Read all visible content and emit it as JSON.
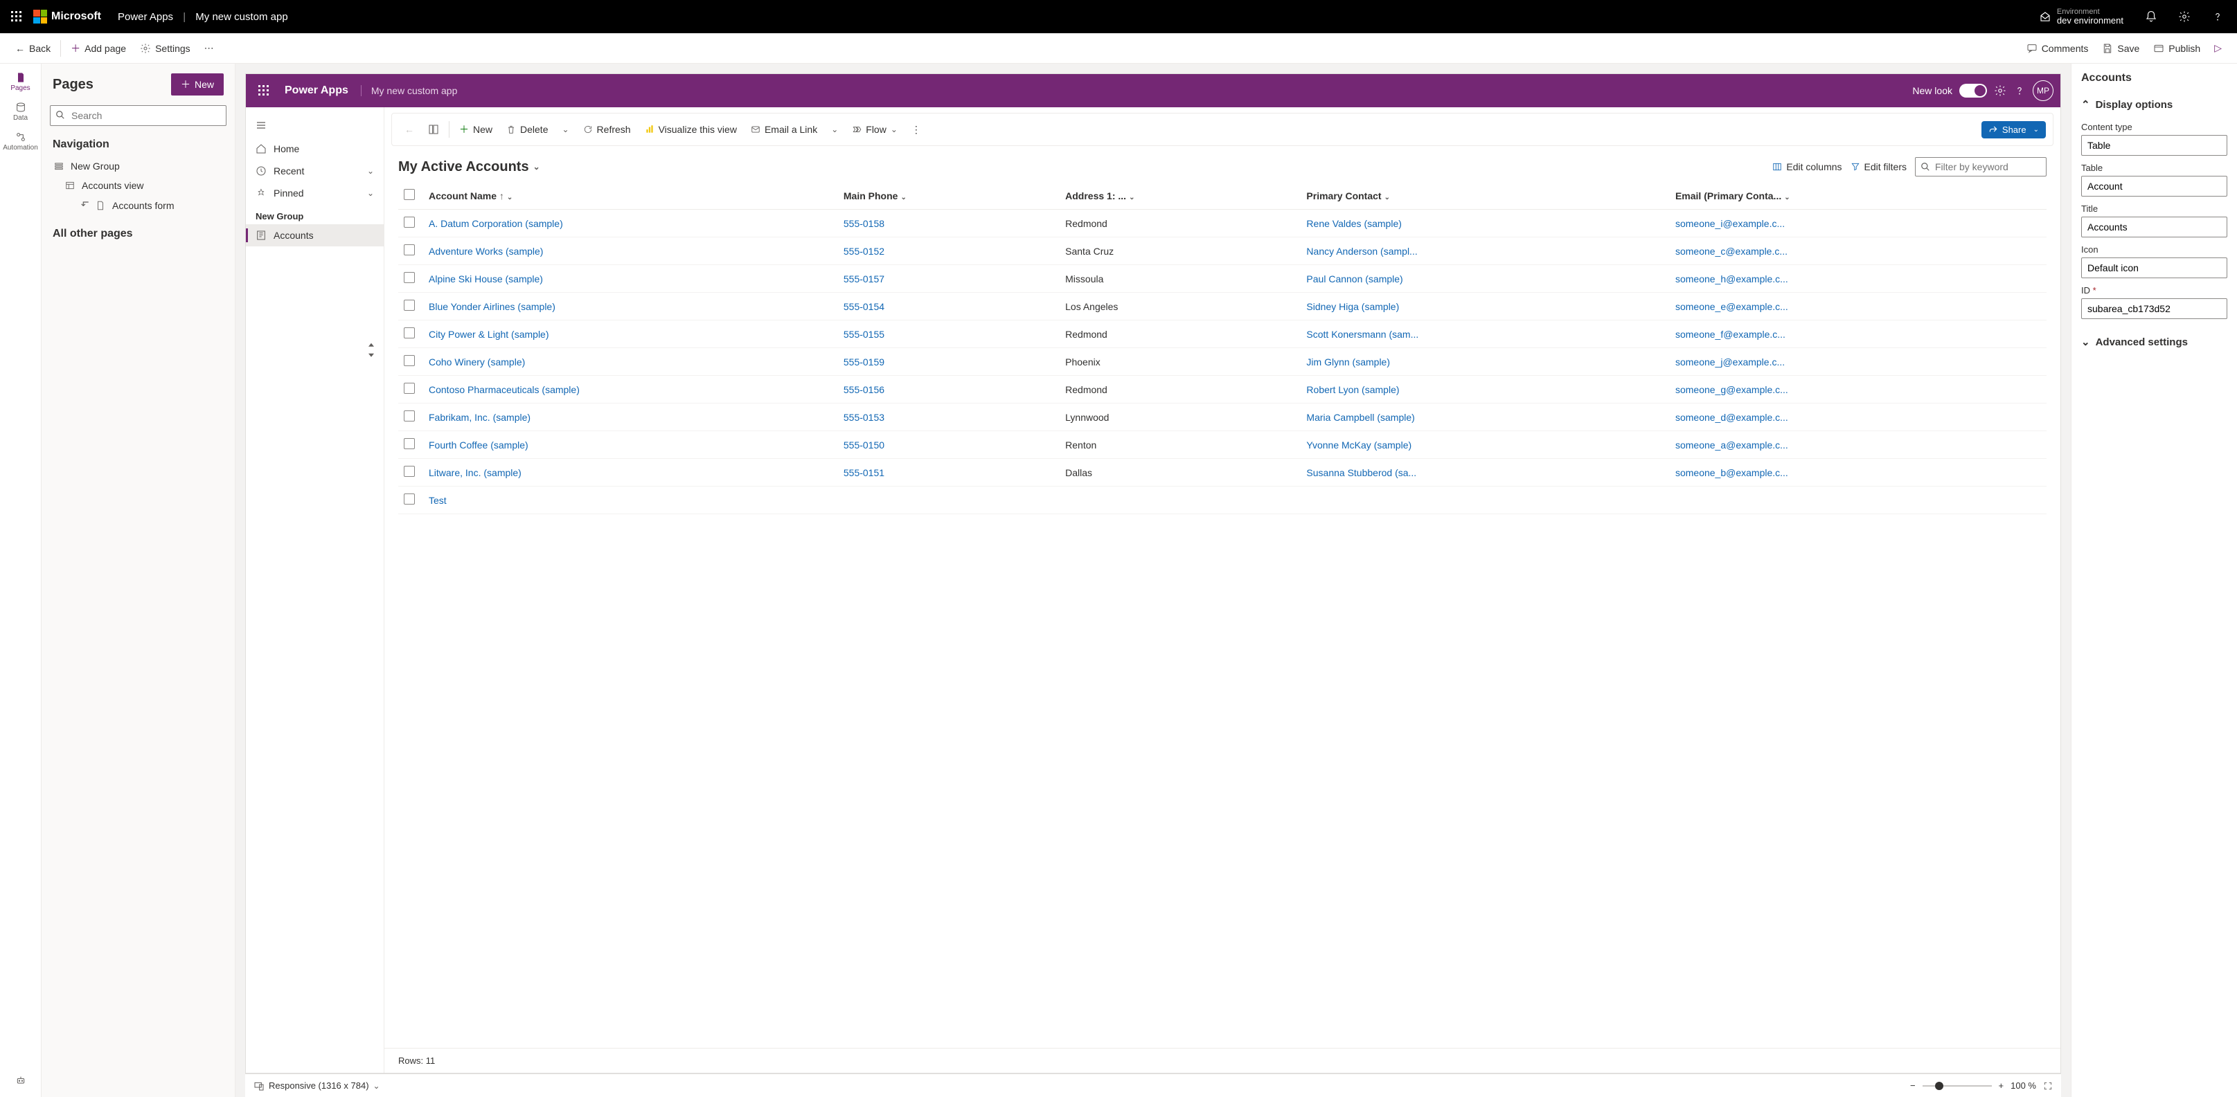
{
  "topbar": {
    "brand": "Microsoft",
    "app": "Power Apps",
    "subtitle": "My new custom app",
    "env_label": "Environment",
    "env_name": "dev environment"
  },
  "cmdbar": {
    "back": "Back",
    "add_page": "Add page",
    "settings": "Settings",
    "comments": "Comments",
    "save": "Save",
    "publish": "Publish",
    "play": "P"
  },
  "leftrail": {
    "pages": "Pages",
    "data": "Data",
    "automation": "Automation"
  },
  "pages_panel": {
    "title": "Pages",
    "new": "New",
    "search_ph": "Search",
    "nav_title": "Navigation",
    "group": "New Group",
    "accounts_view": "Accounts view",
    "accounts_form": "Accounts form",
    "other_title": "All other pages"
  },
  "app_header": {
    "title": "Power Apps",
    "sub": "My new custom app",
    "newlook": "New look",
    "avatar": "MP"
  },
  "app_nav": {
    "home": "Home",
    "recent": "Recent",
    "pinned": "Pinned",
    "group": "New Group",
    "accounts": "Accounts"
  },
  "toolbar": {
    "new": "New",
    "delete": "Delete",
    "refresh": "Refresh",
    "visualize": "Visualize this view",
    "email": "Email a Link",
    "flow": "Flow",
    "share": "Share"
  },
  "view": {
    "title": "My Active Accounts",
    "edit_columns": "Edit columns",
    "edit_filters": "Edit filters",
    "filter_ph": "Filter by keyword"
  },
  "columns": {
    "name": "Account Name",
    "phone": "Main Phone",
    "city": "Address 1: ...",
    "contact": "Primary Contact",
    "email": "Email (Primary Conta..."
  },
  "rows": [
    {
      "name": "A. Datum Corporation (sample)",
      "phone": "555-0158",
      "city": "Redmond",
      "contact": "Rene Valdes (sample)",
      "email": "someone_i@example.c..."
    },
    {
      "name": "Adventure Works (sample)",
      "phone": "555-0152",
      "city": "Santa Cruz",
      "contact": "Nancy Anderson (sampl...",
      "email": "someone_c@example.c..."
    },
    {
      "name": "Alpine Ski House (sample)",
      "phone": "555-0157",
      "city": "Missoula",
      "contact": "Paul Cannon (sample)",
      "email": "someone_h@example.c..."
    },
    {
      "name": "Blue Yonder Airlines (sample)",
      "phone": "555-0154",
      "city": "Los Angeles",
      "contact": "Sidney Higa (sample)",
      "email": "someone_e@example.c..."
    },
    {
      "name": "City Power & Light (sample)",
      "phone": "555-0155",
      "city": "Redmond",
      "contact": "Scott Konersmann (sam...",
      "email": "someone_f@example.c..."
    },
    {
      "name": "Coho Winery (sample)",
      "phone": "555-0159",
      "city": "Phoenix",
      "contact": "Jim Glynn (sample)",
      "email": "someone_j@example.c..."
    },
    {
      "name": "Contoso Pharmaceuticals (sample)",
      "phone": "555-0156",
      "city": "Redmond",
      "contact": "Robert Lyon (sample)",
      "email": "someone_g@example.c..."
    },
    {
      "name": "Fabrikam, Inc. (sample)",
      "phone": "555-0153",
      "city": "Lynnwood",
      "contact": "Maria Campbell (sample)",
      "email": "someone_d@example.c..."
    },
    {
      "name": "Fourth Coffee (sample)",
      "phone": "555-0150",
      "city": "Renton",
      "contact": "Yvonne McKay (sample)",
      "email": "someone_a@example.c..."
    },
    {
      "name": "Litware, Inc. (sample)",
      "phone": "555-0151",
      "city": "Dallas",
      "contact": "Susanna Stubberod (sa...",
      "email": "someone_b@example.c..."
    },
    {
      "name": "Test",
      "phone": "",
      "city": "",
      "contact": "",
      "email": ""
    }
  ],
  "rows_footer": "Rows: 11",
  "statusbar": {
    "responsive": "Responsive (1316 x 784)",
    "zoom": "100 %"
  },
  "properties": {
    "title": "Accounts",
    "display_options": "Display options",
    "content_type_label": "Content type",
    "content_type": "Table",
    "table_label": "Table",
    "table": "Account",
    "title_label": "Title",
    "title_val": "Accounts",
    "icon_label": "Icon",
    "icon": "Default icon",
    "id_label": "ID",
    "id": "subarea_cb173d52",
    "advanced": "Advanced settings"
  }
}
